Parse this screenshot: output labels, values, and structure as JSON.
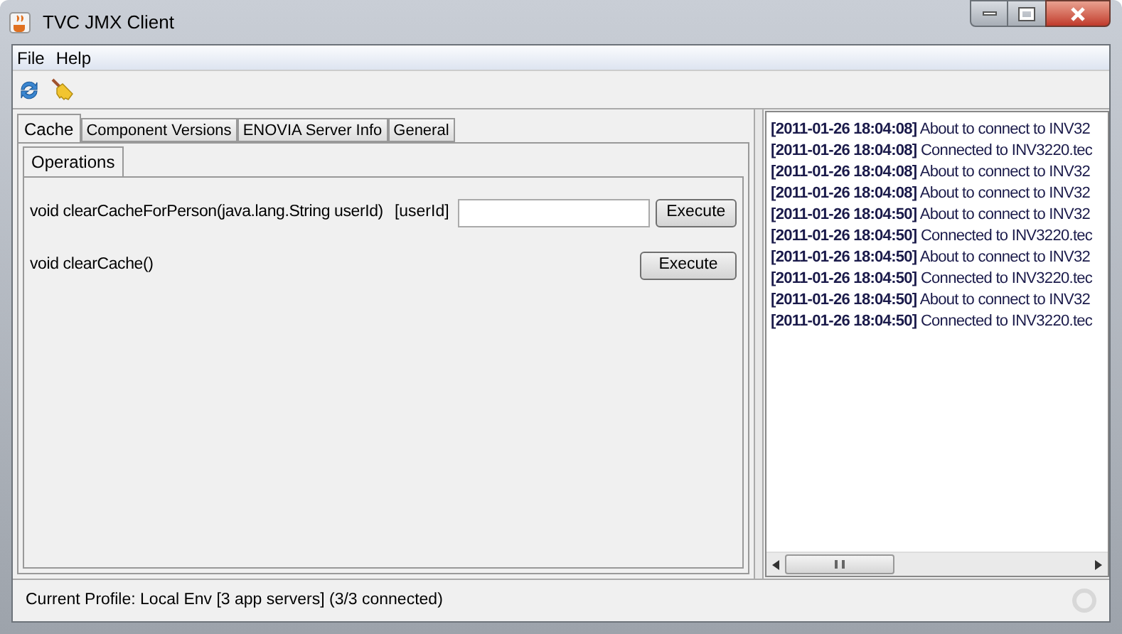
{
  "window": {
    "title": "TVC JMX Client"
  },
  "menu": [
    "File",
    "Help"
  ],
  "tabs": [
    {
      "label": "Cache",
      "selected": true
    },
    {
      "label": "Component Versions",
      "selected": false
    },
    {
      "label": "ENOVIA Server Info",
      "selected": false
    },
    {
      "label": "General",
      "selected": false
    }
  ],
  "subtabs": [
    {
      "label": "Operations",
      "selected": true
    }
  ],
  "operations": [
    {
      "kind": "param",
      "signature": "void clearCacheForPerson(java.lang.String userId)",
      "param_label": "[userId]",
      "button": "Execute"
    },
    {
      "kind": "plain",
      "signature": "void clearCache()",
      "button": "Execute"
    }
  ],
  "log": [
    "**[2011-01-26 18:04:08]** About to connect to INV32",
    "**[2011-01-26 18:04:08]** Connected to INV3220.tec",
    "**[2011-01-26 18:04:08]** About to connect to INV32",
    "**[2011-01-26 18:04:08]** About to connect to INV32",
    "**[2011-01-26 18:04:50]** About to connect to INV32",
    "**[2011-01-26 18:04:50]** Connected to INV3220.tec",
    "**[2011-01-26 18:04:50]** About to connect to INV32",
    "**[2011-01-26 18:04:50]** Connected to INV3220.tec",
    "**[2011-01-26 18:04:50]** About to connect to INV32",
    "**[2011-01-26 18:04:50]** Connected to INV3220.tec"
  ],
  "status_bar": "Current Profile: Local Env [3 app servers] (3/3 connected)"
}
